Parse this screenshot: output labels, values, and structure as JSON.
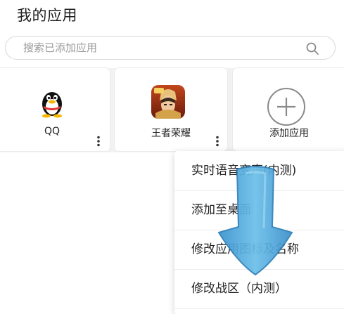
{
  "header": {
    "title": "我的应用"
  },
  "search": {
    "placeholder": "搜索已添加应用",
    "icon": "search-icon"
  },
  "apps": [
    {
      "label": "QQ",
      "icon": "qq-penguin-icon"
    },
    {
      "label": "王者荣耀",
      "icon": "honor-of-kings-icon"
    },
    {
      "label": "添加应用",
      "icon": "plus-circle-icon"
    }
  ],
  "context_menu": {
    "items": [
      {
        "label": "实时语音变声(内测)"
      },
      {
        "label": "添加至桌面"
      },
      {
        "label": "修改应用图标及名称"
      },
      {
        "label": "修改战区（内测）"
      }
    ]
  },
  "overlay": {
    "icon": "down-arrow-icon",
    "color": "#4aa8dc"
  },
  "colors": {
    "grid_background": "#f2f2f2",
    "card_background": "#ffffff",
    "text_primary": "#222222",
    "placeholder": "#9a9a9a"
  }
}
